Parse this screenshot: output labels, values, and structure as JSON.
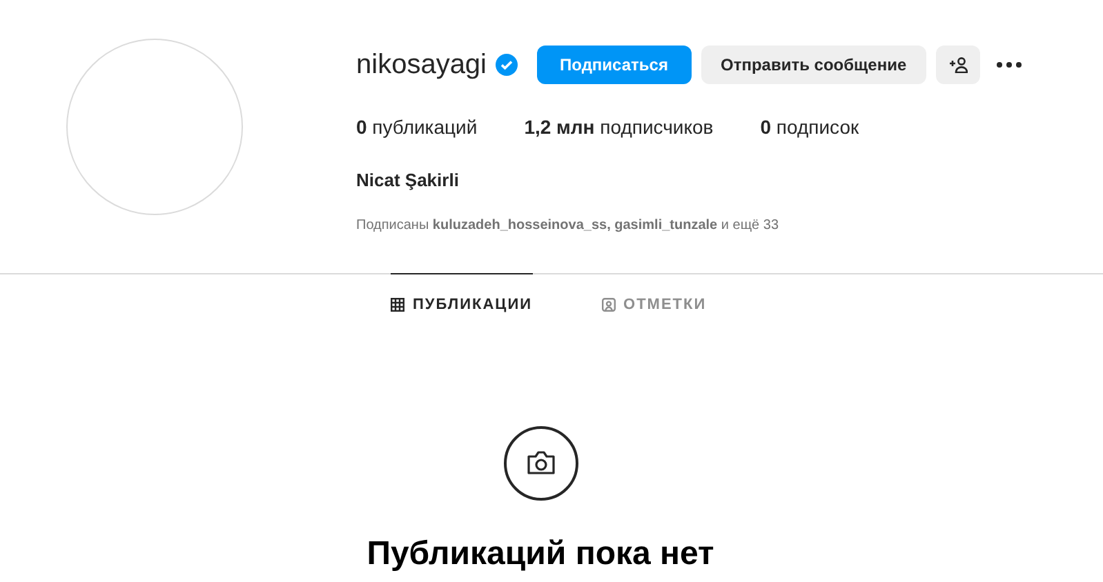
{
  "profile": {
    "username": "nikosayagi",
    "verified": true,
    "buttons": [
      {
        "label": "Подписаться",
        "kind": "primary"
      },
      {
        "label": "Отправить сообщение",
        "kind": "secondary"
      }
    ],
    "stats": [
      "**0** публикаций",
      "**1,2 млн** подписчиков",
      "**0** подписок"
    ],
    "full_name": "Nicat Şakirli",
    "followed_by": "Подписаны **kuluzadeh_hosseinova_ss, gasimli_tunzale** и ещё 33"
  },
  "tabs": [
    {
      "label": "ПУБЛИКАЦИИ",
      "kind": "grid",
      "selected": true
    },
    {
      "label": "ОТМЕТКИ",
      "kind": "tagged",
      "selected": false
    }
  ],
  "empty_state": {
    "title": "Публикаций пока нет"
  }
}
